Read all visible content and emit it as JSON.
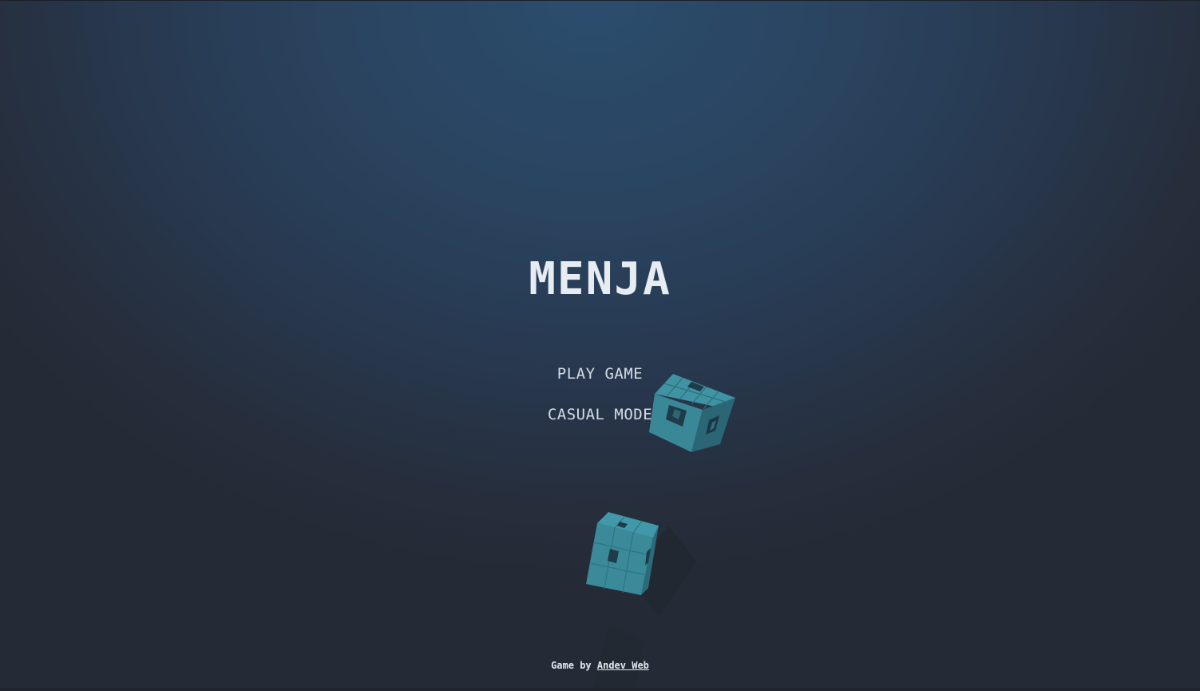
{
  "game": {
    "title": "MENJA"
  },
  "menu": {
    "items": [
      {
        "label": "PLAY GAME"
      },
      {
        "label": "CASUAL MODE"
      }
    ]
  },
  "credit": {
    "prefix": "Game by ",
    "author_link": "Andev Web"
  },
  "colors": {
    "background_top": "#2b4d6d",
    "background_bottom": "#252b36",
    "cube_face": "#3d8c9c",
    "cube_side": "#2a6675",
    "shadow": "#212832",
    "text": "#e6ecf2"
  },
  "icons": [
    "floating-cube-icon",
    "falling-cube-icon",
    "cube-shadow-icon"
  ]
}
